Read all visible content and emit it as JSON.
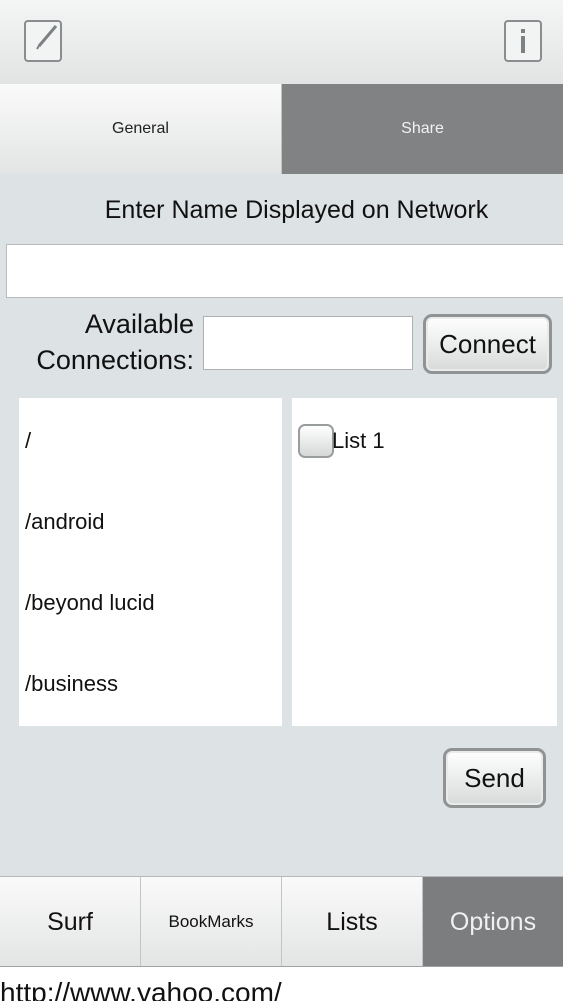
{
  "topbar": {
    "left_icon": "edit-icon",
    "right_icon": "info-icon"
  },
  "tabs": [
    {
      "label": "General",
      "active": false
    },
    {
      "label": "Share",
      "active": true
    }
  ],
  "share": {
    "heading": "Enter Name Displayed on Network",
    "name_input_value": "",
    "connections_label_line1": "Available",
    "connections_label_line2": "Connections:",
    "connection_input_value": "",
    "connect_label": "Connect",
    "connections": [
      "/",
      "/android",
      "/beyond lucid",
      "/business"
    ],
    "lists": [
      {
        "label": "List 1",
        "checked": false
      }
    ],
    "send_label": "Send"
  },
  "bottom_tabs": [
    {
      "label": "Surf",
      "active": false
    },
    {
      "label": "BookMarks",
      "active": false
    },
    {
      "label": "Lists",
      "active": false
    },
    {
      "label": "Options",
      "active": true
    }
  ],
  "url": "http://www.yahoo.com/"
}
